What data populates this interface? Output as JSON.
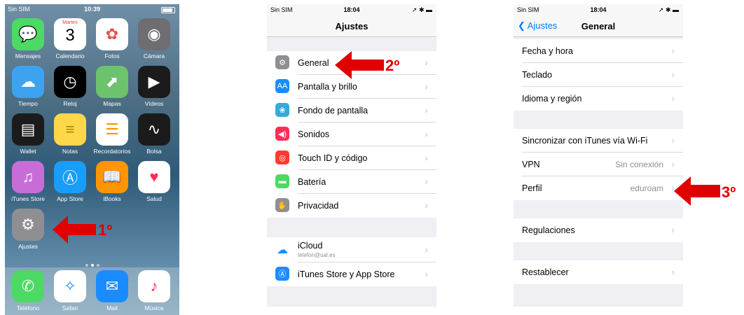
{
  "home": {
    "status": {
      "carrier": "Sin SIM",
      "time": "10:39"
    },
    "apps": [
      {
        "label": "Mensajes",
        "icon": "messages-icon",
        "color": "#4cd964"
      },
      {
        "label": "Calendario",
        "icon": "calendar-icon",
        "color": "#ffffff",
        "day": "Martes",
        "date": "3"
      },
      {
        "label": "Fotos",
        "icon": "photos-icon",
        "color": "#ffffff"
      },
      {
        "label": "Cámara",
        "icon": "camera-icon",
        "color": "#6d6d72"
      },
      {
        "label": "Tiempo",
        "icon": "weather-icon",
        "color": "#3ba3f0"
      },
      {
        "label": "Reloj",
        "icon": "clock-icon",
        "color": "#000000"
      },
      {
        "label": "Mapas",
        "icon": "maps-icon",
        "color": "#6cc36b"
      },
      {
        "label": "Vídeos",
        "icon": "videos-icon",
        "color": "#1b1b1b"
      },
      {
        "label": "Wallet",
        "icon": "wallet-icon",
        "color": "#1b1b1b"
      },
      {
        "label": "Notas",
        "icon": "notes-icon",
        "color": "#ffd84a"
      },
      {
        "label": "Recordatorios",
        "icon": "reminders-icon",
        "color": "#ffffff"
      },
      {
        "label": "Bolsa",
        "icon": "stocks-icon",
        "color": "#1b1b1b"
      },
      {
        "label": "iTunes Store",
        "icon": "itunes-icon",
        "color": "#c86dd7"
      },
      {
        "label": "App Store",
        "icon": "appstore-icon",
        "color": "#1a9df8"
      },
      {
        "label": "iBooks",
        "icon": "ibooks-icon",
        "color": "#ff9500"
      },
      {
        "label": "Salud",
        "icon": "health-icon",
        "color": "#ffffff"
      },
      {
        "label": "Ajustes",
        "icon": "settings-icon",
        "color": "#8e8e93"
      }
    ],
    "dock": [
      {
        "label": "Teléfono",
        "icon": "phone-icon",
        "color": "#4cd964"
      },
      {
        "label": "Safari",
        "icon": "safari-icon",
        "color": "#ffffff"
      },
      {
        "label": "Mail",
        "icon": "mail-icon",
        "color": "#1a8cff"
      },
      {
        "label": "Música",
        "icon": "music-icon",
        "color": "#ffffff"
      }
    ],
    "step": "1º"
  },
  "ajustes": {
    "status": {
      "carrier": "Sin SIM",
      "time": "18:04"
    },
    "title": "Ajustes",
    "rows": [
      {
        "label": "General",
        "color": "#8e8e93",
        "icon": "gear-icon"
      },
      {
        "label": "Pantalla y brillo",
        "color": "#1a8cff",
        "icon": "display-icon",
        "glyph": "AA"
      },
      {
        "label": "Fondo de pantalla",
        "color": "#34aadc",
        "icon": "wallpaper-icon"
      },
      {
        "label": "Sonidos",
        "color": "#ff2d55",
        "icon": "sounds-icon"
      },
      {
        "label": "Touch ID y código",
        "color": "#ff3b30",
        "icon": "fingerprint-icon"
      },
      {
        "label": "Batería",
        "color": "#4cd964",
        "icon": "battery-icon"
      },
      {
        "label": "Privacidad",
        "color": "#8e8e93",
        "icon": "privacy-hand-icon"
      }
    ],
    "icloud": {
      "label": "iCloud",
      "sub": "telefon@ual.es"
    },
    "itunes": {
      "label": "iTunes Store y App Store"
    },
    "step": "2º"
  },
  "general": {
    "status": {
      "carrier": "Sin SIM",
      "time": "18:04"
    },
    "back": "Ajustes",
    "title": "General",
    "group1": [
      "Fecha y hora",
      "Teclado",
      "Idioma y región"
    ],
    "group2": [
      {
        "label": "Sincronizar con iTunes vía Wi-Fi",
        "value": ""
      },
      {
        "label": "VPN",
        "value": "Sin conexión"
      },
      {
        "label": "Perfil",
        "value": "eduroam"
      }
    ],
    "group3": [
      "Regulaciones"
    ],
    "group4": [
      "Restablecer"
    ],
    "step": "3º"
  },
  "colors": {
    "accent": "#007aff",
    "arrow": "#e00000"
  }
}
